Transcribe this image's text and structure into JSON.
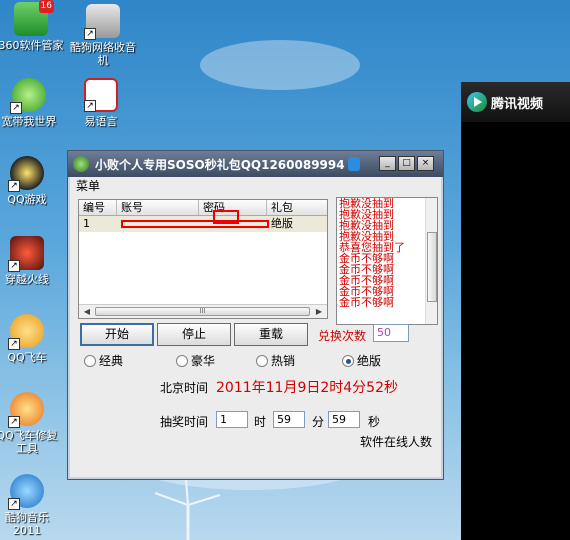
{
  "desktop": {
    "icons": [
      {
        "label": "360软件管家",
        "icon": "360-software-manager-icon",
        "badge": "16"
      },
      {
        "label": "酷狗网络收音机",
        "icon": "kugou-radio-icon"
      },
      {
        "label": "宽带我世界",
        "icon": "broadband-world-icon"
      },
      {
        "label": "易语言",
        "icon": "e-language-icon"
      },
      {
        "label": "QQ游戏",
        "icon": "qq-game-icon"
      },
      {
        "label": "穿越火线",
        "icon": "crossfire-icon"
      },
      {
        "label": "QQ飞车",
        "icon": "qq-speed-icon"
      },
      {
        "label": "QQ飞车修复工具",
        "icon": "qq-speed-repair-icon"
      },
      {
        "label": "酷狗音乐2011",
        "icon": "kugou-music-icon"
      }
    ]
  },
  "tencent_video": {
    "title": "腾讯视频"
  },
  "window": {
    "title": "小败个人专用SOSO秒礼包QQ1260089994",
    "minimize": "_",
    "maximize": "□",
    "close": "×",
    "menu": "菜单",
    "table": {
      "headers": [
        "编号",
        "账号",
        "密码",
        "礼包"
      ],
      "rows": [
        {
          "id": "1",
          "account": "",
          "password": "",
          "gift": "绝版"
        }
      ],
      "scroll_thumb": "III"
    },
    "log_lines": [
      "抱歉没抽到",
      "抱歉没抽到",
      "抱歉没抽到",
      "抱歉没抽到",
      "恭喜您抽到了",
      "金币不够啊",
      "金币不够啊",
      "金币不够啊",
      "金币不够啊",
      "金币不够啊"
    ],
    "buttons": {
      "start": "开始",
      "stop": "停止",
      "reset": "重载"
    },
    "redeem": {
      "label": "兑换次数",
      "value": "50"
    },
    "radios": [
      {
        "label": "经典",
        "checked": false
      },
      {
        "label": "豪华",
        "checked": false
      },
      {
        "label": "热销",
        "checked": false
      },
      {
        "label": "绝版",
        "checked": true
      }
    ],
    "beijing_time": {
      "label": "北京时间",
      "value": "2011年11月9日2时4分52秒"
    },
    "draw_time": {
      "label": "抽奖时间",
      "hour": "1",
      "hour_unit": "时",
      "minute": "59",
      "minute_unit": "分",
      "second": "59",
      "second_unit": "秒"
    },
    "online_label": "软件在线人数"
  },
  "colors": {
    "accent_red": "#d00000",
    "title_bar": "#4a5870",
    "redeem_value": "#b040b0"
  }
}
